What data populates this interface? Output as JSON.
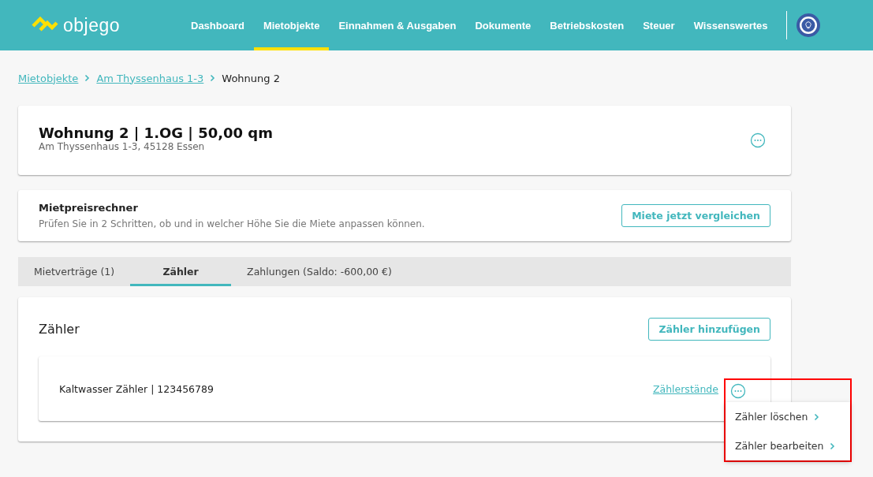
{
  "header": {
    "logo": "objego",
    "nav": [
      {
        "label": "Dashboard",
        "selected": false
      },
      {
        "label": "Mietobjekte",
        "selected": true
      },
      {
        "label": "Einnahmen & Ausgaben",
        "selected": false
      },
      {
        "label": "Dokumente",
        "selected": false
      },
      {
        "label": "Betriebskosten",
        "selected": false
      },
      {
        "label": "Steuer",
        "selected": false
      },
      {
        "label": "Wissenswertes",
        "selected": false
      }
    ]
  },
  "breadcrumb": [
    {
      "label": "Mietobjekte",
      "kind": "link"
    },
    {
      "label": "Am Thyssenhaus 1-3",
      "kind": "link"
    },
    {
      "label": "Wohnung 2",
      "kind": "current"
    }
  ],
  "unit": {
    "title": "Wohnung 2 | 1.OG | 50,00 qm",
    "address": "Am Thyssenhaus 1-3, 45128 Essen"
  },
  "rent_calculator": {
    "title": "Mietpreisrechner",
    "text": "Prüfen Sie in 2 Schritten, ob und in welcher Höhe Sie die Miete anpassen können.",
    "button": "Miete jetzt vergleichen"
  },
  "tabs": [
    {
      "label": "Mietverträge (1)",
      "selected": false
    },
    {
      "label": "Zähler",
      "selected": true
    },
    {
      "label": "Zahlungen (Saldo: -600,00 €)",
      "selected": false
    }
  ],
  "meters": {
    "title": "Zähler",
    "add_button": "Zähler hinzufügen",
    "items": [
      {
        "name": "Kaltwasser Zähler | 123456789",
        "link": "Zählerstände",
        "menu_open": true,
        "menu": [
          "Zähler löschen",
          "Zähler bearbeiten"
        ]
      }
    ]
  }
}
